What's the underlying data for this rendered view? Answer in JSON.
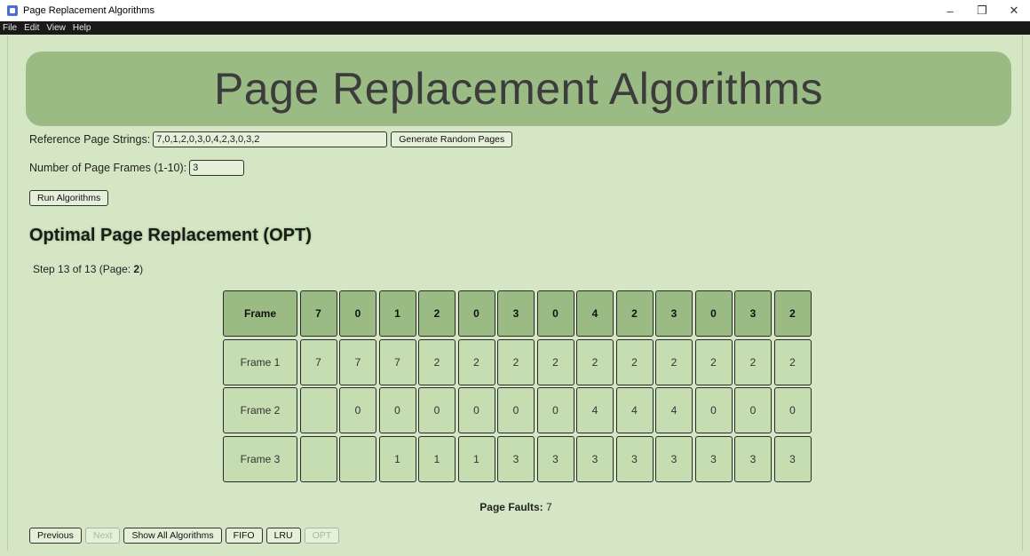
{
  "window": {
    "title": "Page Replacement Algorithms",
    "controls": [
      "–",
      "❐",
      "✕"
    ]
  },
  "menu": [
    "File",
    "Edit",
    "View",
    "Help"
  ],
  "banner": {
    "title": "Page Replacement Algorithms"
  },
  "reference": {
    "label": "Reference Page Strings:",
    "value": "7,0,1,2,0,3,0,4,2,3,0,3,2",
    "generate_button": "Generate Random Pages"
  },
  "frames_input": {
    "label": "Number of Page Frames (1-10):",
    "value": "3"
  },
  "run_button": "Run Algorithms",
  "section": {
    "title": "Optimal Page Replacement (OPT)"
  },
  "step": {
    "prefix": "Step 13 of 13 (Page: ",
    "page": "2",
    "suffix": ")"
  },
  "table": {
    "header_label": "Frame",
    "pages": [
      "7",
      "0",
      "1",
      "2",
      "0",
      "3",
      "0",
      "4",
      "2",
      "3",
      "0",
      "3",
      "2"
    ],
    "rows": [
      {
        "label": "Frame 1",
        "cells": [
          "7",
          "7",
          "7",
          "2",
          "2",
          "2",
          "2",
          "2",
          "2",
          "2",
          "2",
          "2",
          "2"
        ]
      },
      {
        "label": "Frame 2",
        "cells": [
          "",
          "0",
          "0",
          "0",
          "0",
          "0",
          "0",
          "4",
          "4",
          "4",
          "0",
          "0",
          "0"
        ]
      },
      {
        "label": "Frame 3",
        "cells": [
          "",
          "",
          "1",
          "1",
          "1",
          "3",
          "3",
          "3",
          "3",
          "3",
          "3",
          "3",
          "3"
        ]
      }
    ]
  },
  "faults": {
    "label": "Page Faults:",
    "value": "7"
  },
  "nav": {
    "previous": "Previous",
    "next": "Next",
    "show_all": "Show All Algorithms",
    "fifo": "FIFO",
    "lru": "LRU",
    "opt": "OPT"
  }
}
